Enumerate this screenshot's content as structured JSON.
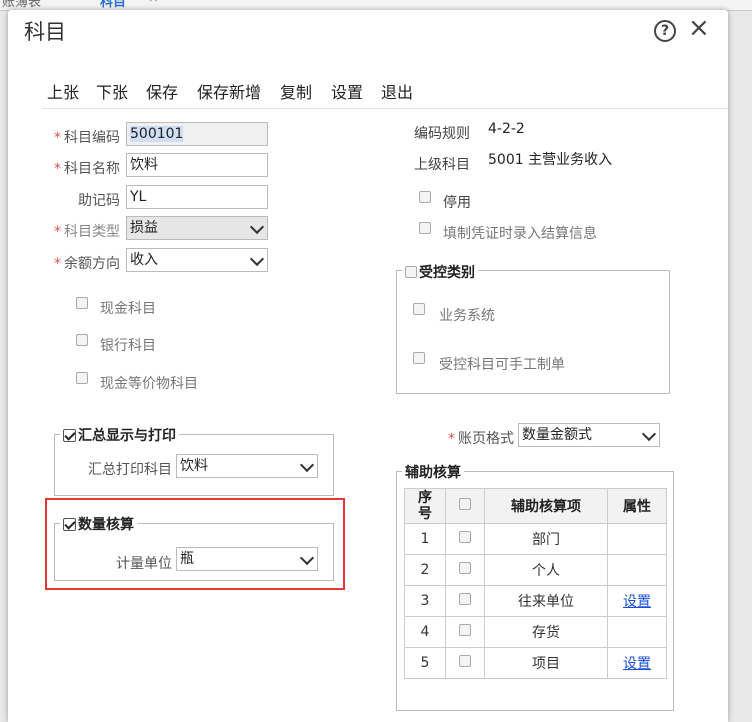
{
  "background": {
    "tab1": "账簿表",
    "tab2": "科目",
    "tab2_close": "×"
  },
  "dialog": {
    "title": "科目",
    "help_icon": "?",
    "close_icon": "×"
  },
  "toolbar": {
    "items": [
      "上张",
      "下张",
      "保存",
      "保存新增",
      "复制",
      "设置",
      "退出"
    ]
  },
  "form": {
    "code": {
      "label": "科目编码",
      "value": "500101"
    },
    "name": {
      "label": "科目名称",
      "value": "饮料"
    },
    "mnemonic": {
      "label": "助记码",
      "value": "YL"
    },
    "type": {
      "label": "科目类型",
      "value": "损益"
    },
    "direction": {
      "label": "余额方向",
      "value": "收入"
    },
    "cash": "现金科目",
    "bank": "银行科目",
    "cash_equiv": "现金等价物科目"
  },
  "right": {
    "rule_label": "编码规则",
    "rule_value": "4-2-2",
    "parent_label": "上级科目",
    "parent_value": "5001 主营业务收入",
    "disabled": "停用",
    "settlement": "填制凭证时录入结算信息",
    "controlled": {
      "title": "受控类别",
      "biz": "业务系统",
      "manual": "受控科目可手工制单"
    },
    "ledger_label": "账页格式",
    "ledger_value": "数量金额式"
  },
  "summary": {
    "title": "汇总显示与打印",
    "print_label": "汇总打印科目",
    "print_value": "饮料"
  },
  "quantity": {
    "title": "数量核算",
    "unit_label": "计量单位",
    "unit_value": "瓶"
  },
  "aux": {
    "title": "辅助核算",
    "headers": {
      "seq": "序号",
      "item": "辅助核算项",
      "attr": "属性"
    },
    "rows": [
      {
        "seq": "1",
        "item": "部门",
        "attr": ""
      },
      {
        "seq": "2",
        "item": "个人",
        "attr": ""
      },
      {
        "seq": "3",
        "item": "往来单位",
        "attr": "设置"
      },
      {
        "seq": "4",
        "item": "存货",
        "attr": ""
      },
      {
        "seq": "5",
        "item": "项目",
        "attr": "设置"
      }
    ]
  }
}
